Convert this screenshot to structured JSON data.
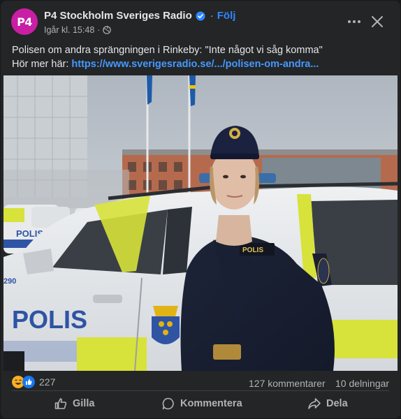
{
  "header": {
    "avatar_text": "P4",
    "page_name": "P4 Stockholm Sveriges Radio",
    "separator": "·",
    "follow_label": "Följ",
    "timestamp": "Igår kl. 15:48",
    "meta_separator": "·",
    "privacy_icon": "globe-icon",
    "more_icon": "more-horizontal-icon",
    "close_icon": "close-icon"
  },
  "post": {
    "line1": "Polisen om andra sprängningen i Rinkeby: \"Inte något vi såg komma\"",
    "line2_prefix": "Hör mer här: ",
    "link_text": "https://www.sverigesradio.se/.../polisen-om-andra..."
  },
  "photo": {
    "car_text": "POLIS",
    "badge_text": "POLIS",
    "small_car_text": "POLIS",
    "car_number": "290"
  },
  "stats": {
    "reaction_count": "227",
    "comments": "127 kommentarer",
    "shares": "10 delningar"
  },
  "actions": {
    "like_label": "Gilla",
    "comment_label": "Kommentera",
    "share_label": "Dela"
  },
  "colors": {
    "background": "#242526",
    "link": "#4599ff",
    "follow": "#2d88ff",
    "avatar": "#c81fa5"
  }
}
